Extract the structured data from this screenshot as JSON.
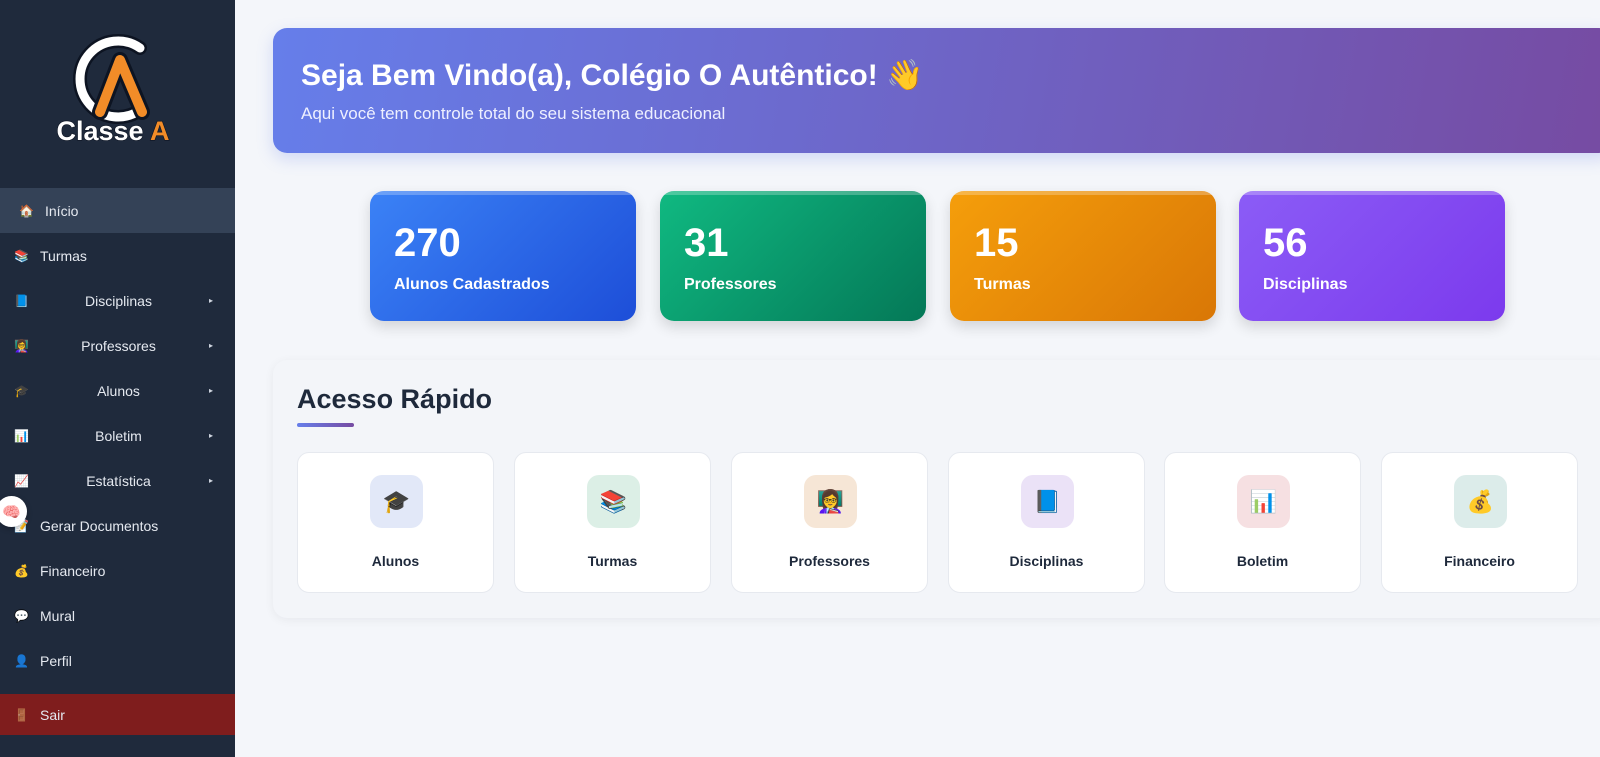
{
  "brand": {
    "logo_text": "Classe A",
    "logo_letters": "CA",
    "logo_accent": "#f28c28"
  },
  "sidebar": {
    "items": [
      {
        "key": "inicio",
        "label": "Início",
        "icon": "house-icon",
        "glyph": "🏠",
        "active": true,
        "submenu": false
      },
      {
        "key": "turmas",
        "label": "Turmas",
        "icon": "books-icon",
        "glyph": "📚",
        "active": false,
        "submenu": false
      },
      {
        "key": "disciplinas",
        "label": "Disciplinas",
        "icon": "blue-book-icon",
        "glyph": "📘",
        "active": false,
        "submenu": true
      },
      {
        "key": "professores",
        "label": "Professores",
        "icon": "teacher-icon",
        "glyph": "👩‍🏫",
        "active": false,
        "submenu": true
      },
      {
        "key": "alunos",
        "label": "Alunos",
        "icon": "graduation-cap-icon",
        "glyph": "🎓",
        "active": false,
        "submenu": true
      },
      {
        "key": "boletim",
        "label": "Boletim",
        "icon": "bar-chart-icon",
        "glyph": "📊",
        "active": false,
        "submenu": true
      },
      {
        "key": "estatistica",
        "label": "Estatística",
        "icon": "trend-chart-icon",
        "glyph": "📈",
        "active": false,
        "submenu": true
      },
      {
        "key": "gerar-documentos",
        "label": "Gerar Documentos",
        "icon": "document-icon",
        "glyph": "📝",
        "active": false,
        "submenu": false
      },
      {
        "key": "financeiro",
        "label": "Financeiro",
        "icon": "money-bag-icon",
        "glyph": "💰",
        "active": false,
        "submenu": false
      },
      {
        "key": "mural",
        "label": "Mural",
        "icon": "speech-bubble-icon",
        "glyph": "💬",
        "active": false,
        "submenu": false
      },
      {
        "key": "perfil",
        "label": "Perfil",
        "icon": "user-icon",
        "glyph": "👤",
        "active": false,
        "submenu": false
      }
    ],
    "logout": {
      "label": "Sair",
      "icon": "door-icon",
      "glyph": "🚪"
    },
    "caret_glyph": "▸",
    "floating_button": {
      "icon": "brain-icon",
      "glyph": "🧠"
    }
  },
  "hero": {
    "title": "Seja Bem Vindo(a), Colégio O Autêntico! 👋",
    "subtitle": "Aqui você tem controle total do seu sistema educacional",
    "gradient": [
      "#667eea",
      "#764ba2"
    ]
  },
  "stats": [
    {
      "value": "270",
      "label": "Alunos Cadastrados",
      "color": "#3b82f6"
    },
    {
      "value": "31",
      "label": "Professores",
      "color": "#10b981"
    },
    {
      "value": "15",
      "label": "Turmas",
      "color": "#f59e0b"
    },
    {
      "value": "56",
      "label": "Disciplinas",
      "color": "#8b5cf6"
    }
  ],
  "quick_access": {
    "title": "Acesso Rápido",
    "cards": [
      {
        "label": "Alunos",
        "icon": "graduation-cap-icon",
        "glyph": "🎓",
        "bg": "#e2e8f8"
      },
      {
        "label": "Turmas",
        "icon": "books-icon",
        "glyph": "📚",
        "bg": "#dcefe6"
      },
      {
        "label": "Professores",
        "icon": "teacher-icon",
        "glyph": "👩‍🏫",
        "bg": "#f6e6d6"
      },
      {
        "label": "Disciplinas",
        "icon": "blue-book-icon",
        "glyph": "📘",
        "bg": "#ebe2f7"
      },
      {
        "label": "Boletim",
        "icon": "bar-chart-icon",
        "glyph": "📊",
        "bg": "#f6e0e2"
      },
      {
        "label": "Financeiro",
        "icon": "money-bag-icon",
        "glyph": "💰",
        "bg": "#dcecea"
      }
    ]
  }
}
